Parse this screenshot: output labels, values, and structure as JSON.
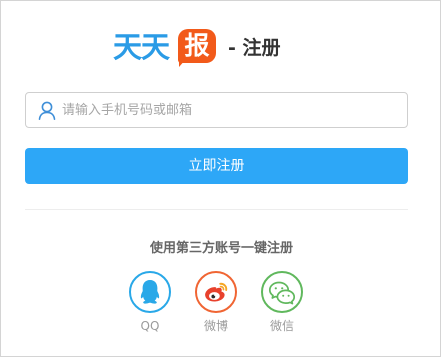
{
  "header": {
    "logo_text": "天天",
    "logo_badge": "报",
    "page_suffix": "- 注册"
  },
  "form": {
    "phone_placeholder": "请输入手机号码或邮箱",
    "phone_value": "",
    "register_label": "立即注册"
  },
  "third_party": {
    "title": "使用第三方账号一键注册",
    "providers": [
      {
        "label": "QQ",
        "icon": "qq-icon",
        "color": "#29a8e8"
      },
      {
        "label": "微博",
        "icon": "weibo-icon",
        "color": "#f06533"
      },
      {
        "label": "微信",
        "icon": "wechat-icon",
        "color": "#60b85d"
      }
    ]
  },
  "colors": {
    "brand_blue": "#2a9be6",
    "brand_orange": "#f25a1a",
    "button": "#2da7f7"
  }
}
